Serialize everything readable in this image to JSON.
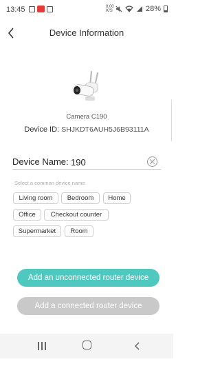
{
  "status_bar": {
    "time": "13:45",
    "net_speed_top": "0.00",
    "net_speed_bottom": "K/S",
    "battery": "28%"
  },
  "header": {
    "title": "Device Information"
  },
  "device": {
    "model": "Camera C190",
    "id_label": "Device ID:",
    "id_value": "SHJKDT6AUH5J6B93111A"
  },
  "name_field": {
    "label": "Device Name:",
    "value": "190"
  },
  "suggestions": {
    "hint": "Select a common device name",
    "chips": [
      "Living room",
      "Bedroom",
      "Home",
      "Office",
      "Checkout counter",
      "Supermarket",
      "Room"
    ]
  },
  "actions": {
    "primary_label": "Add an unconnected router device",
    "secondary_label": "Add a connected router device"
  },
  "colors": {
    "accent": "#4fc9c0",
    "disabled": "#c9c9c9"
  }
}
